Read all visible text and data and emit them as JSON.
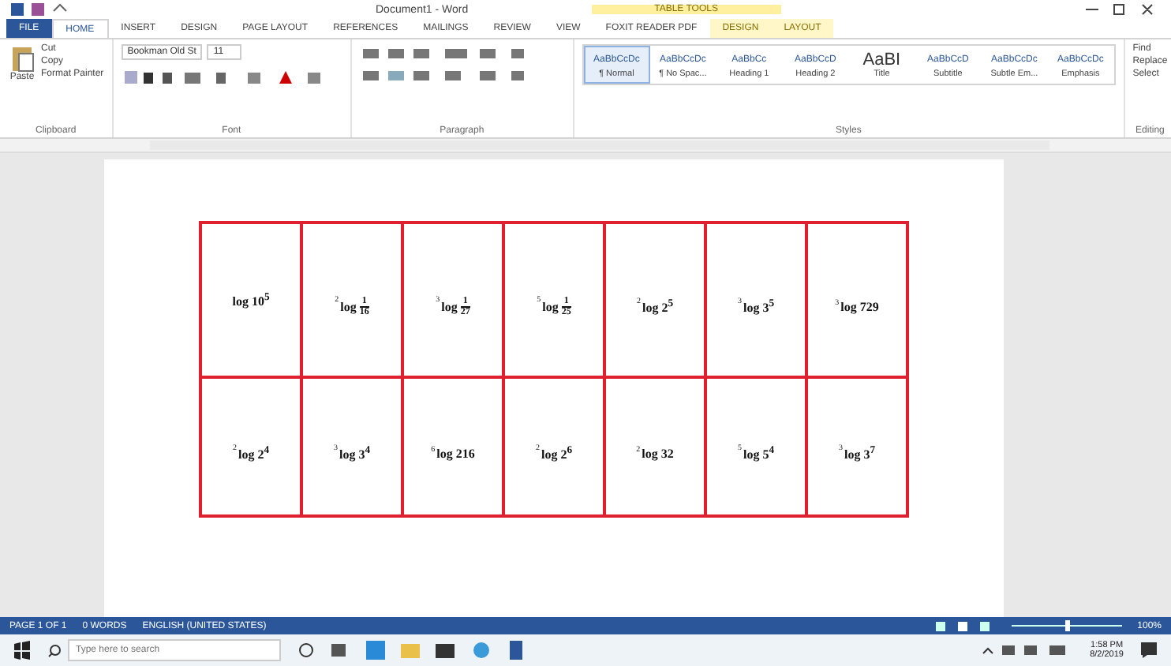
{
  "window": {
    "title": "Document1 - Word",
    "context_label": "TABLE TOOLS"
  },
  "tabs": [
    {
      "label": "FILE",
      "selected": false,
      "kind": "file"
    },
    {
      "label": "HOME",
      "selected": true,
      "kind": "normal"
    },
    {
      "label": "INSERT",
      "selected": false,
      "kind": "normal"
    },
    {
      "label": "DESIGN",
      "selected": false,
      "kind": "normal"
    },
    {
      "label": "PAGE LAYOUT",
      "selected": false,
      "kind": "normal"
    },
    {
      "label": "REFERENCES",
      "selected": false,
      "kind": "normal"
    },
    {
      "label": "MAILINGS",
      "selected": false,
      "kind": "normal"
    },
    {
      "label": "REVIEW",
      "selected": false,
      "kind": "normal"
    },
    {
      "label": "VIEW",
      "selected": false,
      "kind": "normal"
    },
    {
      "label": "FOXIT READER PDF",
      "selected": false,
      "kind": "normal"
    },
    {
      "label": "DESIGN",
      "selected": false,
      "kind": "context"
    },
    {
      "label": "LAYOUT",
      "selected": false,
      "kind": "context"
    }
  ],
  "ribbon": {
    "clipboard": {
      "paste": "Paste",
      "items": [
        "Cut",
        "Copy",
        "Format Painter"
      ],
      "label": "Clipboard"
    },
    "font": {
      "family": "Bookman Old St",
      "size": "11",
      "label": "Font"
    },
    "paragraph": {
      "label": "Paragraph"
    },
    "styles": {
      "label": "Styles",
      "items": [
        {
          "sample": "AaBbCcDc",
          "name": "¶ Normal",
          "selected": true
        },
        {
          "sample": "AaBbCcDc",
          "name": "¶ No Spac...",
          "selected": false
        },
        {
          "sample": "AaBbCc",
          "name": "Heading 1",
          "selected": false
        },
        {
          "sample": "AaBbCcD",
          "name": "Heading 2",
          "selected": false
        },
        {
          "sample": "AaBI",
          "name": "Title",
          "selected": false
        },
        {
          "sample": "AaBbCcD",
          "name": "Subtitle",
          "selected": false
        },
        {
          "sample": "AaBbCcDc",
          "name": "Subtle Em...",
          "selected": false
        },
        {
          "sample": "AaBbCcDc",
          "name": "Emphasis",
          "selected": false
        }
      ]
    },
    "editing": {
      "label": "Editing",
      "items": [
        "Find",
        "Replace",
        "Select"
      ]
    }
  },
  "table": {
    "rows": [
      [
        {
          "kind": "power",
          "arg": "log 10$^{5}$"
        },
        {
          "kind": "fraction",
          "base": "2",
          "fn": "log",
          "num": "1",
          "den": "16"
        },
        {
          "kind": "fraction",
          "base": "3",
          "fn": "log",
          "num": "1",
          "den": "27"
        },
        {
          "kind": "fraction",
          "base": "5",
          "fn": "log",
          "num": "1",
          "den": "25"
        },
        {
          "kind": "power",
          "base": "2",
          "arg": "log 2$^{5}$"
        },
        {
          "kind": "power",
          "base": "3",
          "arg": "log 3$^{5}$"
        },
        {
          "kind": "power",
          "base": "3",
          "arg": "log 729"
        }
      ],
      [
        {
          "kind": "power",
          "base": "2",
          "arg": "log 2$^{4}$"
        },
        {
          "kind": "power",
          "base": "3",
          "arg": "log 3$^{4}$"
        },
        {
          "kind": "power",
          "base": "6",
          "arg": "log 216"
        },
        {
          "kind": "power",
          "base": "2",
          "arg": "log 2$^{6}$"
        },
        {
          "kind": "power",
          "base": "2",
          "arg": "log 32"
        },
        {
          "kind": "power",
          "base": "5",
          "arg": "log 5$^{4}$"
        },
        {
          "kind": "power",
          "base": "3",
          "arg": "log 3$^{7}$"
        }
      ]
    ]
  },
  "status_bar": {
    "page": "PAGE 1 OF 1",
    "words": "0 WORDS",
    "language": "ENGLISH (UNITED STATES)",
    "zoom": "100%",
    "level": 0.5
  },
  "taskbar": {
    "search_placeholder": "Type here to search",
    "time": "1:58 PM",
    "date": "8/2/2019"
  }
}
